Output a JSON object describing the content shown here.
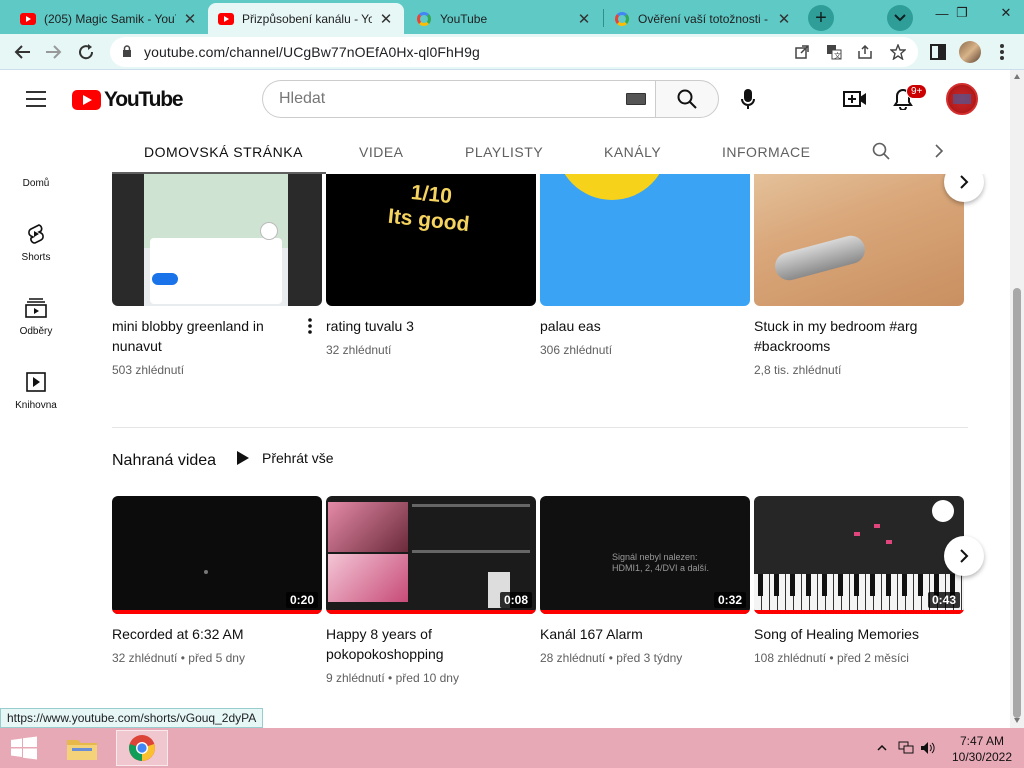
{
  "browser": {
    "tabs": [
      {
        "title": "(205) Magic Samik - YouT",
        "favicon": "youtube-icon",
        "active": false
      },
      {
        "title": "Přizpůsobení kanálu - You",
        "favicon": "youtube-icon",
        "active": true
      },
      {
        "title": "YouTube",
        "favicon": "google-icon",
        "active": false
      },
      {
        "title": "Ověření vaší totožnosti -",
        "favicon": "google-icon",
        "active": false
      }
    ],
    "url": "youtube.com/channel/UCgBw77nOEfA0Hx-ql0FhH9g",
    "status_url": "https://www.youtube.com/shorts/vGouq_2dyPA"
  },
  "youtube": {
    "logo_text": "YouTube",
    "search_placeholder": "Hledat",
    "notifications_badge": "9+",
    "sidebar": [
      {
        "label": "Domů",
        "icon": "home-icon"
      },
      {
        "label": "Shorts",
        "icon": "shorts-icon"
      },
      {
        "label": "Odběry",
        "icon": "subscriptions-icon"
      },
      {
        "label": "Knihovna",
        "icon": "library-icon"
      }
    ],
    "channel_tabs": [
      {
        "label": "DOMOVSKÁ STRÁNKA",
        "active": true
      },
      {
        "label": "VIDEA",
        "active": false
      },
      {
        "label": "PLAYLISTY",
        "active": false
      },
      {
        "label": "KANÁLY",
        "active": false
      },
      {
        "label": "INFORMACE",
        "active": false
      }
    ],
    "shorts_row": [
      {
        "title": "mini blobby greenland in nunavut",
        "meta": "503 zhlédnutí"
      },
      {
        "title": "rating tuvalu 3",
        "meta": "32 zhlédnutí",
        "overlay": "1/10\nIts good"
      },
      {
        "title": "palau eas",
        "meta": "306 zhlédnutí"
      },
      {
        "title": "Stuck in my bedroom #arg #backrooms",
        "meta": "2,8 tis. zhlédnutí"
      }
    ],
    "section": {
      "title": "Nahraná videa",
      "play_all": "Přehrát vše"
    },
    "uploads_row": [
      {
        "title": "Recorded at 6:32 AM",
        "views": "32 zhlédnutí",
        "age": "před 5 dny",
        "duration": "0:20"
      },
      {
        "title": "Happy 8 years of pokopokoshopping",
        "views": "9 zhlédnutí",
        "age": "před 10 dny",
        "duration": "0:08"
      },
      {
        "title": "Kanál 167 Alarm",
        "views": "28 zhlédnutí",
        "age": "před 3 týdny",
        "duration": "0:32",
        "screen_text": "Signál nebyl nalezen:\nHDMI1, 2, 4/DVI a další."
      },
      {
        "title": "Song of Healing Memories",
        "views": "108 zhlédnutí",
        "age": "před 2 měsíci",
        "duration": "0:43"
      }
    ]
  },
  "taskbar": {
    "time": "7:47 AM",
    "date": "10/30/2022"
  }
}
